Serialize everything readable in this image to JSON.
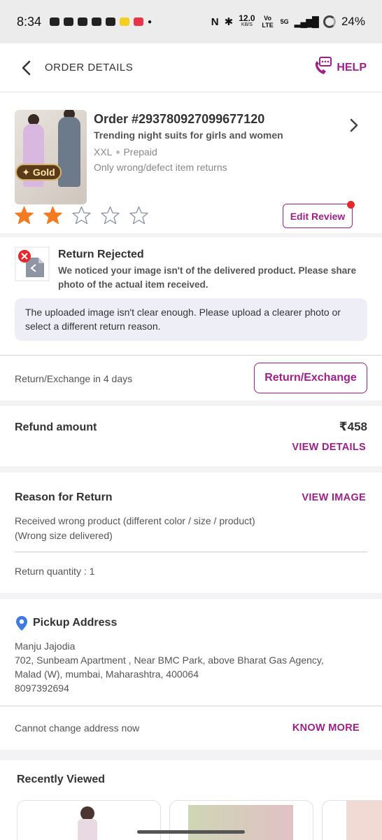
{
  "status_bar": {
    "time": "8:34",
    "speed_value": "12.0",
    "speed_unit": "KB/S",
    "volte": "Vo LTE",
    "network": "5G",
    "battery": "24%"
  },
  "header": {
    "title": "ORDER DETAILS",
    "help_label": "HELP"
  },
  "order": {
    "badge": "✦ Gold",
    "order_id": "Order #293780927099677120",
    "product_name": "Trending night suits for girls and women",
    "size": "XXL",
    "payment": "Prepaid",
    "return_policy": "Only wrong/defect item returns",
    "rating": 2,
    "rating_max": 5,
    "edit_review_label": "Edit Review"
  },
  "return_status": {
    "title": "Return Rejected",
    "message": "We noticed your image isn't of the delivered product. Please share photo of the actual item received.",
    "note": "The uploaded image isn't clear enough. Please upload a clearer photo or select a different return reason."
  },
  "return_exchange": {
    "window_text": "Return/Exchange in 4 days",
    "button_label": "Return/Exchange"
  },
  "refund": {
    "label": "Refund amount",
    "amount": "₹458",
    "link_label": "VIEW DETAILS"
  },
  "reason": {
    "label": "Reason for Return",
    "link_label": "VIEW IMAGE",
    "text_line1": "Received wrong product (different color / size / product)",
    "text_line2": "(Wrong size delivered)",
    "quantity": "Return quantity : 1"
  },
  "pickup": {
    "title": "Pickup Address",
    "name": "Manju Jajodia",
    "address_line1": "702, Sunbeam Apartment , Near BMC Park, above Bharat Gas Agency,",
    "address_line2": "Malad (W), mumbai, Maharashtra, 400064",
    "phone": "8097392694",
    "change_note": "Cannot change address now",
    "know_more_label": "KNOW MORE"
  },
  "recently_viewed": {
    "title": "Recently Viewed"
  },
  "colors": {
    "accent": "#9f2089",
    "star_filled": "#f47c20",
    "notification_dot": "#e8262b"
  }
}
